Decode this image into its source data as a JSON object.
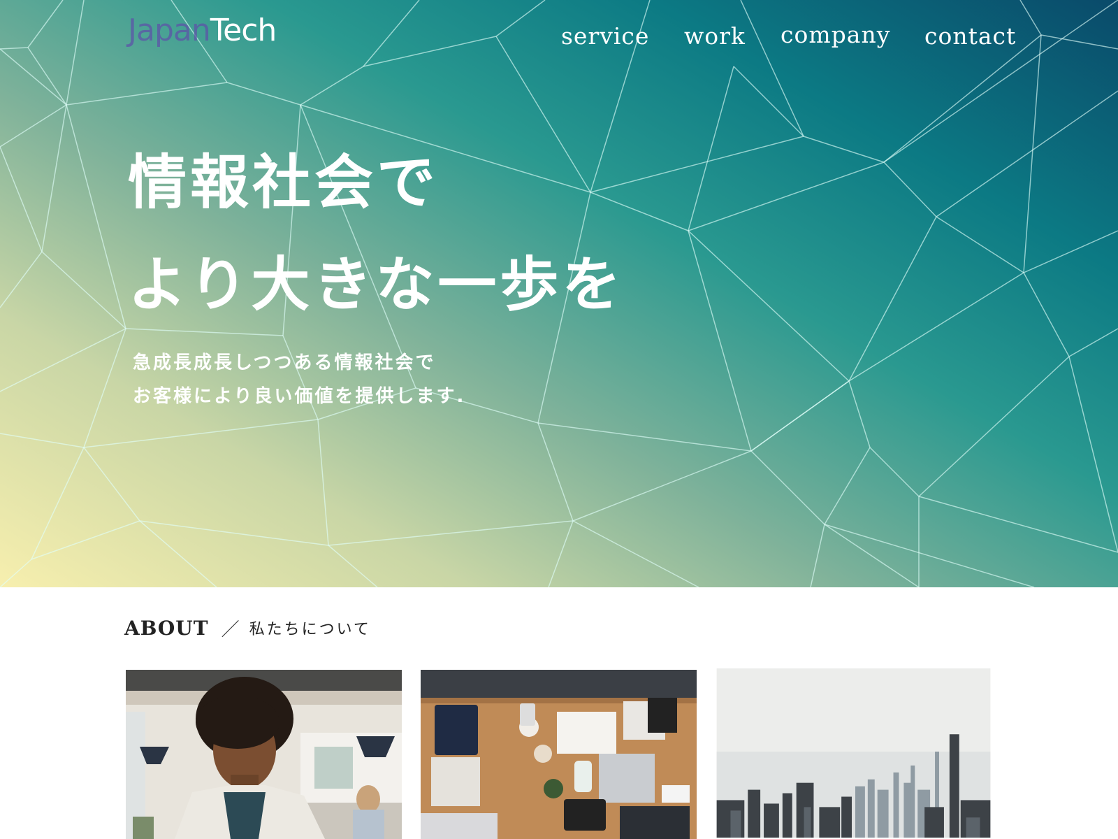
{
  "header": {
    "logo": {
      "part1": "Japan",
      "part2": "Tech"
    },
    "nav": [
      {
        "label": "service"
      },
      {
        "label": "work"
      },
      {
        "label": "company"
      },
      {
        "label": "contact"
      }
    ]
  },
  "hero": {
    "headline": [
      "情報社会で",
      "より大きな一歩を"
    ],
    "subtext": [
      "急成長成長しつつある情報社会で",
      "お客様により良い価値を提供します."
    ]
  },
  "about": {
    "heading_en": "ABOUT",
    "separator": "／",
    "heading_ja": "私たちについて"
  },
  "photos": [
    {
      "subject": "woman-working-in-office"
    },
    {
      "subject": "team-meeting-desk-overhead"
    },
    {
      "subject": "city-skyline"
    }
  ],
  "colors": {
    "hero_gradient_dark": "#0a4a6a",
    "hero_gradient_mid": "#2a9990",
    "hero_gradient_light": "#f7efae",
    "text_light": "#ffffff",
    "heading_dark": "#222222"
  }
}
